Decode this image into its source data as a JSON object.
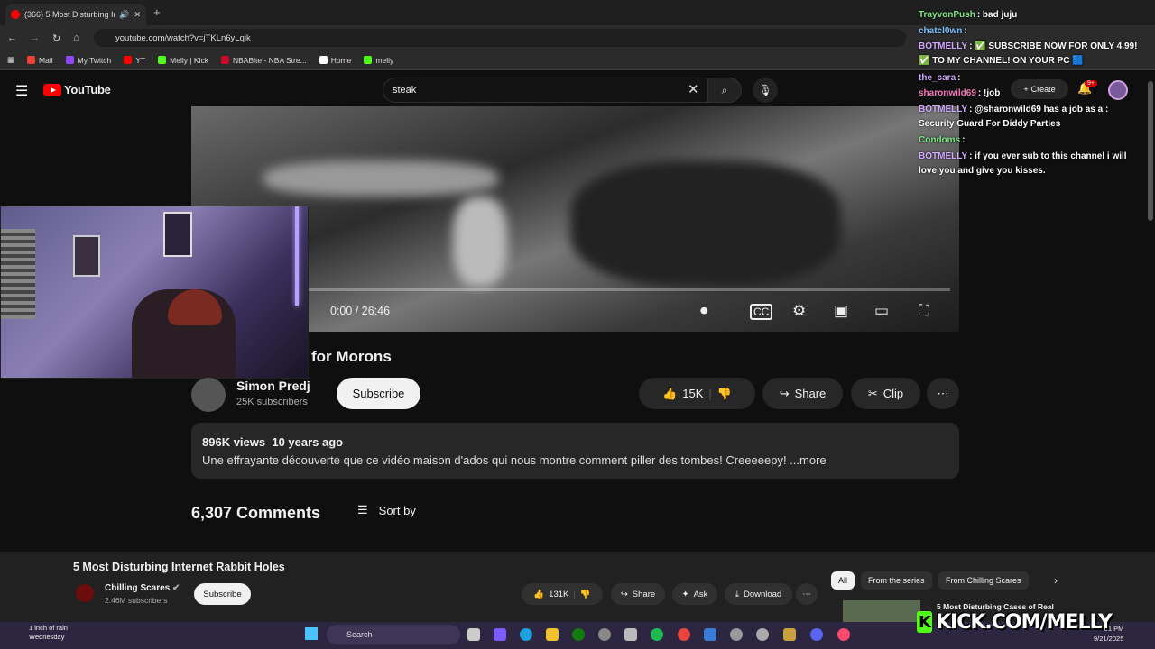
{
  "browser": {
    "tab_title": "(366) 5 Most Disturbing Int",
    "new_tab": "+",
    "url": "youtube.com/watch?v=jTKLn6yLqik",
    "bookmarks": [
      {
        "label": "Mail",
        "color": "#ea4335"
      },
      {
        "label": "My Twitch",
        "color": "#9146ff"
      },
      {
        "label": "YT",
        "color": "#ff0000"
      },
      {
        "label": "Melly | Kick",
        "color": "#53fc18"
      },
      {
        "label": "NBABite - NBA Stre...",
        "color": "#c9082a"
      },
      {
        "label": "Home",
        "color": "#ffffff"
      },
      {
        "label": "melly",
        "color": "#53fc18"
      }
    ]
  },
  "youtube": {
    "logo_text": "YouTube",
    "search_value": "steak",
    "create_label": "Create",
    "notif_badge": "9+"
  },
  "video": {
    "time": "0:00 / 26:46",
    "title_visible": "for Morons",
    "channel_name": "Simon Predj",
    "channel_subs": "25K subscribers",
    "subscribe_label": "Subscribe",
    "likes": "15K",
    "share_label": "Share",
    "clip_label": "Clip",
    "views": "896K views",
    "age": "10 years ago",
    "description": "Une effrayante découverte que ce vidéo maison d'ados qui nous montre comment piller des tombes! Creeeeepy! ...more",
    "comments_count": "6,307 Comments",
    "sort_label": "Sort by"
  },
  "miniplayer": {
    "title": "5 Most Disturbing Internet Rabbit Holes",
    "channel": "Chilling Scares",
    "subs": "2.46M subscribers",
    "subscribe_label": "Subscribe",
    "likes": "131K",
    "share_label": "Share",
    "ask_label": "Ask",
    "download_label": "Download",
    "chips": [
      "All",
      "From the series",
      "From Chilling Scares"
    ],
    "related_title": "5 Most Disturbing Cases of Real"
  },
  "chat": [
    {
      "user": "TrayvonPush",
      "color": "#7ee787",
      "text": ": bad juju"
    },
    {
      "user": "chatcl0wn",
      "color": "#79c0ff",
      "text": ":"
    },
    {
      "user": "BOTMELLY",
      "color": "#d2a8ff",
      "text": ": ✅ SUBSCRIBE NOW FOR ONLY 4.99!"
    },
    {
      "user": "",
      "color": "#ffffff",
      "text": "✅ TO MY CHANNEL! ON YOUR PC 🟦"
    },
    {
      "user": "the_cara",
      "color": "#d2a8ff",
      "text": ":"
    },
    {
      "user": "sharonwild69",
      "color": "#f778ba",
      "text": ": !job"
    },
    {
      "user": "BOTMELLY",
      "color": "#d2a8ff",
      "text": ": @sharonwild69 has a job as a :"
    },
    {
      "user": "",
      "color": "#ffffff",
      "text": "Security Guard For Diddy Parties"
    },
    {
      "user": "Condoms",
      "color": "#7ee787",
      "text": ":"
    },
    {
      "user": "BOTMELLY",
      "color": "#d2a8ff",
      "text": ": if you ever sub to this channel i will"
    },
    {
      "user": "",
      "color": "#ffffff",
      "text": "love you and give you kisses."
    }
  ],
  "overlay": {
    "kick_text": "KICK.COM/MELLY"
  },
  "taskbar": {
    "weather_line1": "1 inch of rain",
    "weather_line2": "Wednesday",
    "search_label": "Search",
    "time": "01 PM",
    "date": "9/21/2025"
  },
  "colors": {
    "brand_red": "#ff0000",
    "kick_green": "#53fc18"
  }
}
